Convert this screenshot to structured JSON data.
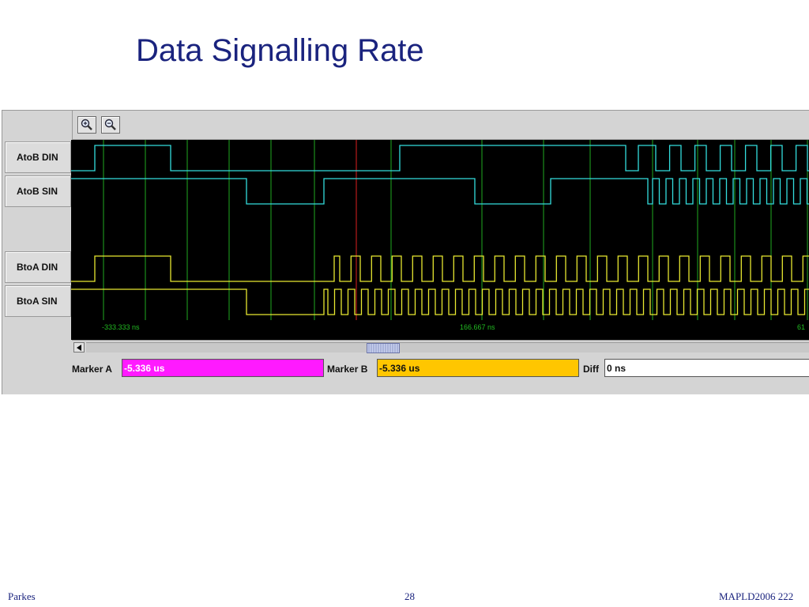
{
  "slide": {
    "title": "Data Signalling Rate",
    "footer_left": "Parkes",
    "footer_center": "28",
    "footer_right": "MAPLD2006 222"
  },
  "toolbar": {
    "zoom_in_icon": "zoom-in-icon",
    "zoom_out_icon": "zoom-out-icon"
  },
  "signals": [
    {
      "label": "AtoB DIN",
      "color": "#33dddd"
    },
    {
      "label": "AtoB SIN",
      "color": "#33dddd"
    },
    {
      "label": "",
      "color": ""
    },
    {
      "label": "BtoA DIN",
      "color": "#e8e830"
    },
    {
      "label": "BtoA SIN",
      "color": "#e8e830"
    }
  ],
  "timeline": {
    "tick_labels": [
      "-333.333 ns",
      "166.667 ns",
      "61"
    ]
  },
  "markers": {
    "marker_a_label": "Marker A",
    "marker_a_value": "-5.336 us",
    "marker_a_color": "#ff1aff",
    "marker_b_label": "Marker B",
    "marker_b_value": "-5.336 us",
    "marker_b_color": "#ffc600",
    "diff_label": "Diff",
    "diff_value": "0 ns"
  },
  "colors": {
    "waveform_bg": "#000000",
    "grid_green": "#1faa1f",
    "marker_red": "#dd2020",
    "timeline_text": "#22bb22",
    "title_blue": "#1a237e"
  }
}
